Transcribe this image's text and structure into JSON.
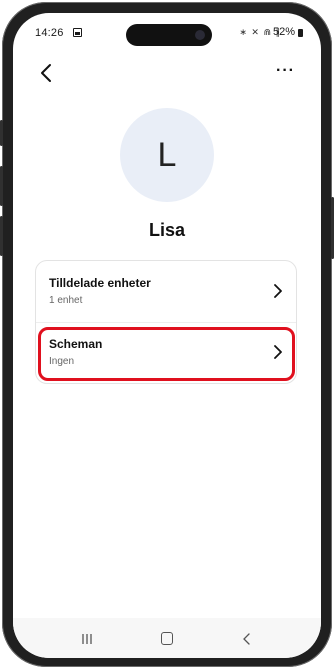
{
  "status_bar": {
    "time": "14:26",
    "icons": "∗ ✕ ⋒ ∥",
    "battery": "52%"
  },
  "header": {
    "back_icon": "chevron-left-icon",
    "more_label": "···"
  },
  "profile": {
    "initial": "L",
    "name": "Lisa"
  },
  "settings": {
    "items": [
      {
        "title": "Tilldelade enheter",
        "subtitle": "1 enhet"
      },
      {
        "title": "Scheman",
        "subtitle": "Ingen"
      }
    ]
  },
  "colors": {
    "highlight": "#e0101e",
    "avatar_bg": "#e9eef7"
  }
}
